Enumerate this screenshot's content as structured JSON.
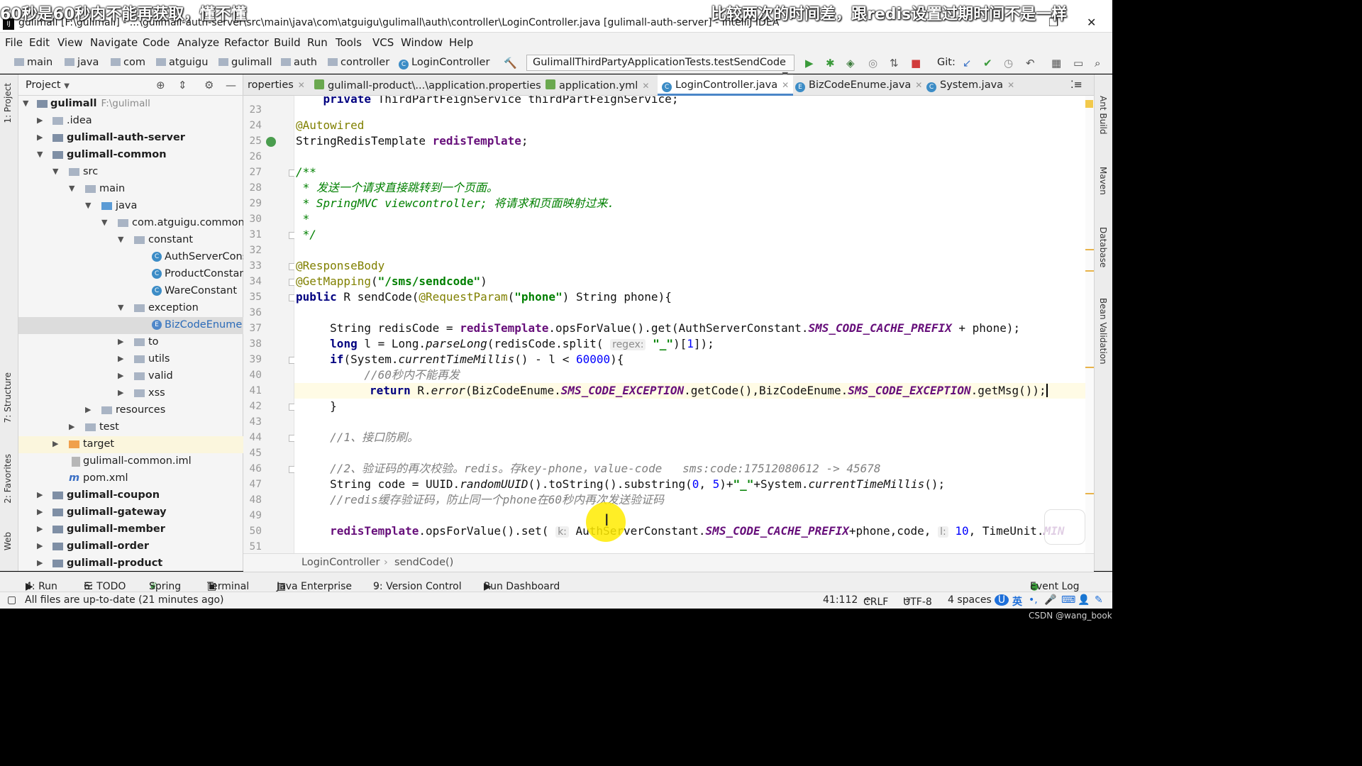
{
  "window": {
    "title": "gulimall [F:\\gulimall] - ...\\gulimall-auth-server\\src\\main\\java\\com\\atguigu\\gulimall\\auth\\controller\\LoginController.java [gulimall-auth-server] - IntelliJ IDEA"
  },
  "danmaku": {
    "left": "60秒是60秒内不能再获取，懂不懂",
    "right": "比较两次的时间差，跟redis设置过期时间不是一样"
  },
  "menu": [
    "File",
    "Edit",
    "View",
    "Navigate",
    "Code",
    "Analyze",
    "Refactor",
    "Build",
    "Run",
    "Tools",
    "VCS",
    "Window",
    "Help"
  ],
  "nav": {
    "crumbs": [
      "main",
      "java",
      "com",
      "atguigu",
      "gulimall",
      "auth",
      "controller",
      "LoginController"
    ],
    "run_config": "GulimallThirdPartyApplicationTests.testSendCode",
    "git_label": "Git:"
  },
  "left_tabs": [
    "1: Project",
    "7: Structure",
    "2: Favorites",
    "Web"
  ],
  "right_tabs": [
    "Ant Build",
    "Maven",
    "Database",
    "Bean Validation"
  ],
  "project": {
    "header": "Project",
    "tree": [
      {
        "label": "gulimall",
        "path": "F:\\gulimall",
        "bold": true
      },
      {
        "label": ".idea"
      },
      {
        "label": "gulimall-auth-server",
        "bold": true
      },
      {
        "label": "gulimall-common",
        "bold": true
      },
      {
        "label": "src"
      },
      {
        "label": "main"
      },
      {
        "label": "java"
      },
      {
        "label": "com.atguigu.common"
      },
      {
        "label": "constant"
      },
      {
        "label": "AuthServerConst"
      },
      {
        "label": "ProductConstant"
      },
      {
        "label": "WareConstant"
      },
      {
        "label": "exception"
      },
      {
        "label": "BizCodeEnume"
      },
      {
        "label": "to"
      },
      {
        "label": "utils"
      },
      {
        "label": "valid"
      },
      {
        "label": "xss"
      },
      {
        "label": "resources"
      },
      {
        "label": "test"
      },
      {
        "label": "target"
      },
      {
        "label": "gulimall-common.iml"
      },
      {
        "label": "pom.xml"
      },
      {
        "label": "gulimall-coupon",
        "bold": true
      },
      {
        "label": "gulimall-gateway",
        "bold": true
      },
      {
        "label": "gulimall-member",
        "bold": true
      },
      {
        "label": "gulimall-order",
        "bold": true
      },
      {
        "label": "gulimall-product",
        "bold": true
      }
    ]
  },
  "tabs": [
    {
      "label": "roperties"
    },
    {
      "label": "gulimall-product\\...\\application.properties"
    },
    {
      "label": "application.yml"
    },
    {
      "label": "LoginController.java",
      "active": true
    },
    {
      "label": "BizCodeEnume.java"
    },
    {
      "label": "System.java"
    }
  ],
  "editor": {
    "line_numbers": [
      "23",
      "24",
      "25",
      "26",
      "27",
      "28",
      "29",
      "30",
      "31",
      "32",
      "33",
      "34",
      "35",
      "36",
      "37",
      "38",
      "39",
      "40",
      "41",
      "42",
      "43",
      "44",
      "45",
      "46",
      "47",
      "48",
      "49",
      "50",
      "51"
    ],
    "code_path": [
      "LoginController",
      "sendCode()"
    ]
  },
  "toolwindows": [
    "4: Run",
    "6: TODO",
    "Spring",
    "Terminal",
    "Java Enterprise",
    "9: Version Control",
    "Run Dashboard",
    "Event Log"
  ],
  "status": {
    "message": "All files are up-to-date (21 minutes ago)",
    "position": "41:112",
    "line_sep": "CRLF",
    "encoding": "UTF-8",
    "indent": "4 spaces",
    "ime": "英"
  },
  "watermark": "CSDN @wang_book"
}
